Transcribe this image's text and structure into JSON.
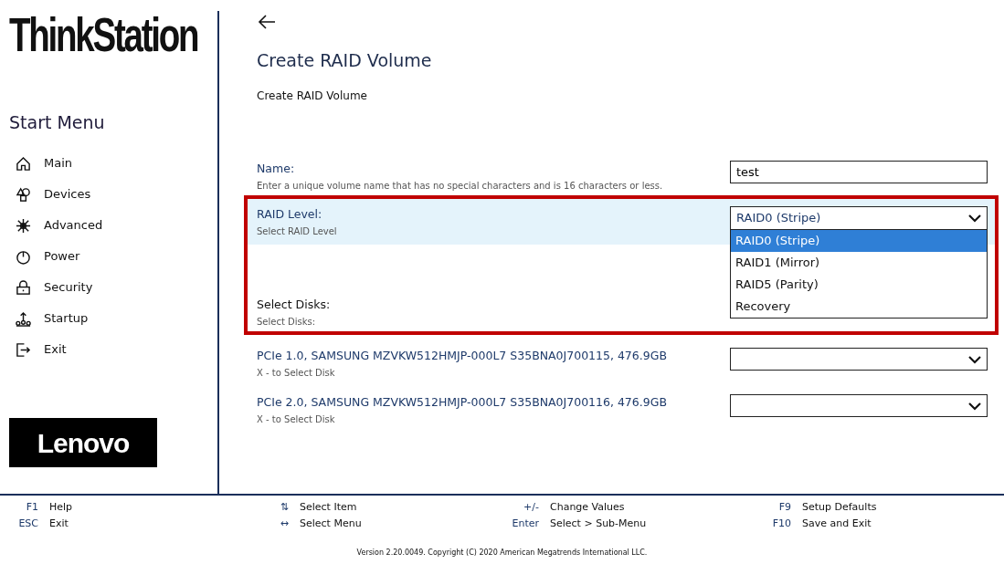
{
  "sidebar": {
    "logo": "ThinkStation",
    "title": "Start Menu",
    "items": [
      {
        "label": "Main",
        "kind": "home"
      },
      {
        "label": "Devices",
        "kind": "devices"
      },
      {
        "label": "Advanced",
        "kind": "advanced"
      },
      {
        "label": "Power",
        "kind": "power"
      },
      {
        "label": "Security",
        "kind": "security"
      },
      {
        "label": "Startup",
        "kind": "startup"
      },
      {
        "label": "Exit",
        "kind": "exit"
      }
    ],
    "brand": "Lenovo"
  },
  "page": {
    "title": "Create RAID Volume",
    "subtitle": "Create RAID Volume",
    "rows": [
      {
        "kind": "text",
        "label": "Name:",
        "help": "Enter a unique volume name that has no special characters and is 16 characters or less.",
        "value": "test",
        "highlighted": false,
        "boxed": false
      },
      {
        "kind": "select",
        "label": "RAID Level:",
        "help": "Select RAID Level",
        "value": "RAID0 (Stripe)",
        "highlighted": true,
        "boxed": true,
        "expanded": true,
        "options": [
          {
            "label": "RAID0 (Stripe)",
            "selected": true
          },
          {
            "label": "RAID1 (Mirror)",
            "selected": false
          },
          {
            "label": "RAID5 (Parity)",
            "selected": false
          },
          {
            "label": "Recovery",
            "selected": false
          }
        ]
      },
      {
        "kind": "heading",
        "label": "Select Disks:",
        "help": "Select Disks:",
        "highlighted": false,
        "boxed": true
      },
      {
        "kind": "select",
        "label": "PCIe 1.0, SAMSUNG MZVKW512HMJP-000L7 S35BNA0J700115, 476.9GB",
        "help": "X - to Select Disk",
        "value": "",
        "highlighted": false,
        "boxed": false,
        "expanded": false
      },
      {
        "kind": "select",
        "label": "PCIe 2.0, SAMSUNG MZVKW512HMJP-000L7 S35BNA0J700116, 476.9GB",
        "help": "X - to Select Disk",
        "value": "",
        "highlighted": false,
        "boxed": false,
        "expanded": false
      }
    ]
  },
  "footer": {
    "keys": [
      {
        "key": "F1",
        "action": "Help"
      },
      {
        "key": "⇅",
        "action": "Select Item"
      },
      {
        "key": "+/-",
        "action": "Change Values"
      },
      {
        "key": "F9",
        "action": "Setup Defaults"
      },
      {
        "key": "ESC",
        "action": "Exit"
      },
      {
        "key": "↔",
        "action": "Select Menu"
      },
      {
        "key": "Enter",
        "action": "Select > Sub-Menu"
      },
      {
        "key": "F10",
        "action": "Save and Exit"
      }
    ],
    "version": "Version 2.20.0049. Copyright (C) 2020 American Megatrends International LLC."
  }
}
